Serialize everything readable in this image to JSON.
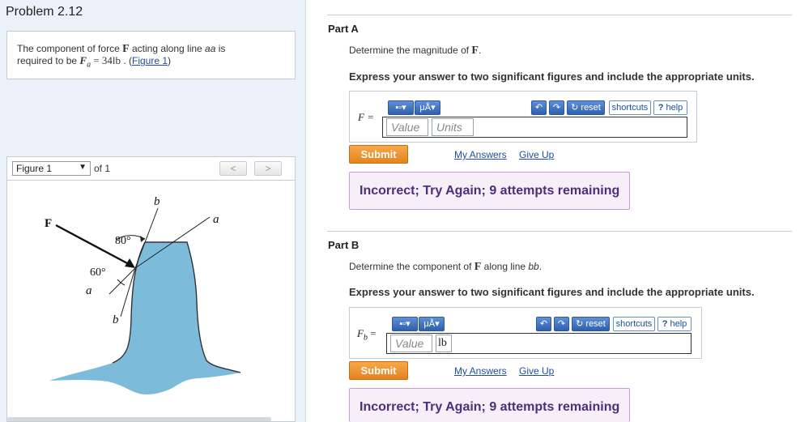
{
  "problem": {
    "title": "Problem 2.12",
    "statement_pre": "The component of force ",
    "statement_force": "F",
    "statement_mid": " acting along line ",
    "statement_line": "aa",
    "statement_is": " is",
    "statement_line2_pre": "required to be ",
    "statement_fa_var": "F",
    "statement_fa_sub": "a",
    "statement_fa_value": " = 34lb",
    "statement_dot": " . (",
    "figure_link": "Figure 1",
    "statement_close": ")"
  },
  "figure_nav": {
    "selected": "Figure 1",
    "of_label": "of 1",
    "prev": "<",
    "next": ">"
  },
  "figure": {
    "label_F": "F",
    "label_b_top": "b",
    "label_a_right": "a",
    "label_80": "80°",
    "label_60": "60°",
    "label_a_left": "a",
    "label_b_bottom": "b",
    "fill_color": "#7cbcda"
  },
  "toolbar": {
    "templates_icon": "▪▫▾",
    "units_icon": "μÅ▾",
    "undo_icon": "↶",
    "redo_icon": "↷",
    "reset": "reset",
    "shortcuts": "shortcuts",
    "help": "help",
    "help_icon": "?",
    "reset_icon": "↻"
  },
  "partA": {
    "title": "Part A",
    "question_pre": "Determine the magnitude of ",
    "question_F": "F",
    "question_post": ".",
    "instructions": "Express your answer to two significant figures and include the appropriate units.",
    "var_label": "F =",
    "value_placeholder": "Value",
    "units_placeholder": "Units",
    "submit": "Submit",
    "my_answers": "My Answers",
    "give_up": "Give Up",
    "feedback": "Incorrect; Try Again; 9 attempts remaining"
  },
  "partB": {
    "title": "Part B",
    "question_pre": "Determine the component of ",
    "question_F": "F",
    "question_mid": " along line ",
    "question_line": "bb",
    "question_post": ".",
    "instructions": "Express your answer to two significant figures and include the appropriate units.",
    "var_label": "F",
    "var_sub": "b",
    "var_eq": " =",
    "value_placeholder": "Value",
    "units_value": "lb",
    "submit": "Submit",
    "my_answers": "My Answers",
    "give_up": "Give Up",
    "feedback": "Incorrect; Try Again; 9 attempts remaining"
  }
}
